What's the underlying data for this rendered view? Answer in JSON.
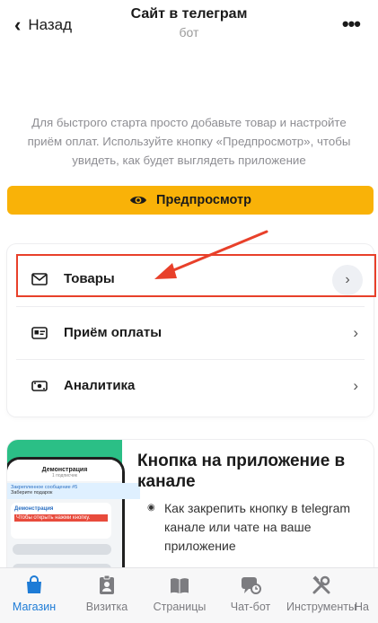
{
  "header": {
    "back_label": "Назад",
    "title": "Сайт в телеграм",
    "subtitle": "бот"
  },
  "info_text": "Для быстрого старта просто добавьте товар и настройте приём оплат. Используйте кнопку «Предпросмотр», чтобы увидеть, как будет выглядеть приложение",
  "preview_button": {
    "label": "Предпросмотр",
    "icon": "eye-icon",
    "color": "#f9b208"
  },
  "menu": {
    "items": [
      {
        "label": "Товары",
        "icon": "envelope-icon"
      },
      {
        "label": "Приём оплаты",
        "icon": "id-card-icon"
      },
      {
        "label": "Аналитика",
        "icon": "wallet-icon"
      }
    ]
  },
  "promo": {
    "title": "Кнопка на приложение в канале",
    "item": "Как закрепить кнопку в telegram канале или чате на ваше приложение",
    "phone": {
      "chat_title": "Демонстрация",
      "chat_subtitle": "1 подписчик",
      "pinned": "Закрепленное сообщение #5",
      "gift": "Заберите подарок",
      "msg_author": "Демонстрация",
      "msg_text": "Чтобы открыть нажми кнопку."
    }
  },
  "tabbar": {
    "active_color": "#1d7bd6",
    "items": [
      {
        "label": "Магазин",
        "icon": "shopping-bag-icon",
        "active": true
      },
      {
        "label": "Визитка",
        "icon": "badge-icon",
        "active": false
      },
      {
        "label": "Страницы",
        "icon": "book-icon",
        "active": false
      },
      {
        "label": "Чат-бот",
        "icon": "chat-bot-icon",
        "active": false
      },
      {
        "label": "Инструменты",
        "icon": "tools-icon",
        "active": false
      },
      {
        "label": "На",
        "icon": "more-icon",
        "active": false
      }
    ]
  },
  "annotation": {
    "color": "#e8402a"
  }
}
